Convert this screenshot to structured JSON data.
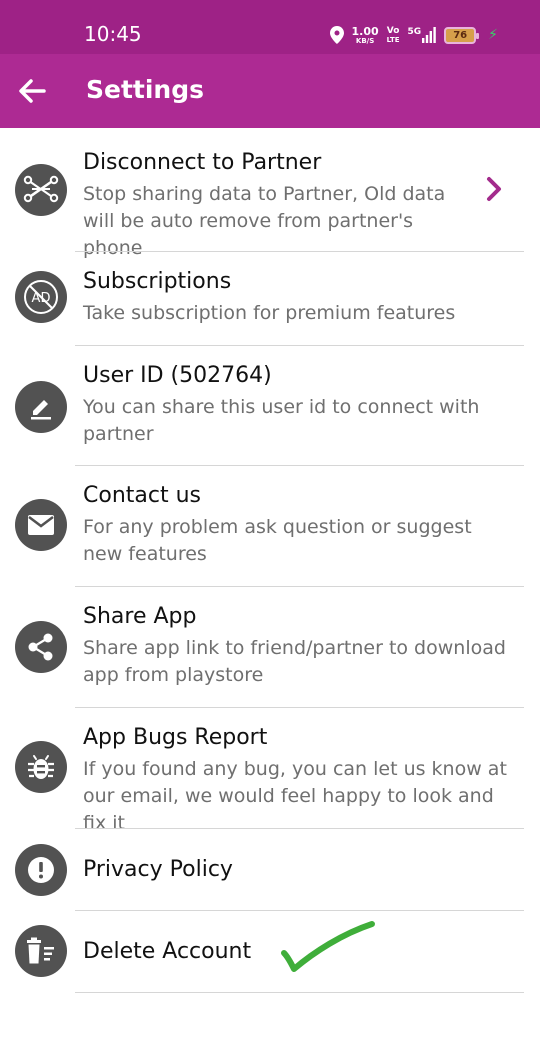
{
  "status_bar": {
    "time": "10:45",
    "net_speed_value": "1.00",
    "net_speed_unit": "KB/S",
    "volte_top": "Vo",
    "volte_bottom": "LTE",
    "network": "5G",
    "battery": "76"
  },
  "app_bar": {
    "title": "Settings"
  },
  "settings": {
    "items": [
      {
        "title": "Disconnect to Partner",
        "subtitle": "Stop sharing data to Partner, Old data will be auto remove from partner's phone",
        "icon": "partner-disconnect-icon"
      },
      {
        "title": "Subscriptions",
        "subtitle": "Take subscription for premium features",
        "icon": "no-ads-icon"
      },
      {
        "title": "User ID (502764)",
        "subtitle": "You can share this user id to connect with partner",
        "icon": "edit-pencil-icon"
      },
      {
        "title": "Contact us",
        "subtitle": "For any problem ask question or suggest new features",
        "icon": "mail-icon"
      },
      {
        "title": "Share App",
        "subtitle": "Share app link to friend/partner to download app from playstore",
        "icon": "share-icon"
      },
      {
        "title": "App Bugs Report",
        "subtitle": "If you found any bug, you can let us know at our email, we would feel happy to look and fix it",
        "icon": "bug-icon"
      },
      {
        "title": "Privacy Policy",
        "subtitle": "",
        "icon": "exclamation-icon"
      },
      {
        "title": "Delete Account",
        "subtitle": "",
        "icon": "delete-account-icon"
      }
    ]
  },
  "colors": {
    "status_bar": "#9e2286",
    "app_bar": "#ad2a93",
    "icon_bg": "#525252",
    "chevron": "#a32b8c",
    "checkmark": "#3fae3a"
  }
}
